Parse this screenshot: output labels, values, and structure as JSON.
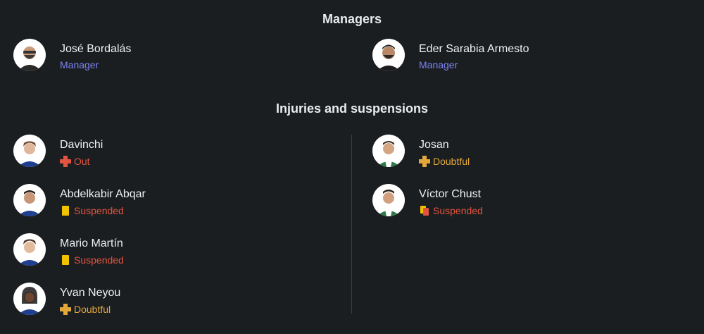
{
  "managers": {
    "title": "Managers",
    "items": [
      {
        "name": "José Bordalás",
        "role": "Manager"
      },
      {
        "name": "Eder Sarabia Armesto",
        "role": "Manager"
      }
    ]
  },
  "injuries": {
    "title": "Injuries and suspensions",
    "left": [
      {
        "name": "Davinchi",
        "status": "Out",
        "status_icon": "red-cross-icon"
      },
      {
        "name": "Abdelkabir Abqar",
        "status": "Suspended",
        "status_icon": "yellow-card-icon"
      },
      {
        "name": "Mario Martín",
        "status": "Suspended",
        "status_icon": "yellow-card-icon"
      },
      {
        "name": "Yvan Neyou",
        "status": "Doubtful",
        "status_icon": "amber-cross-icon"
      }
    ],
    "right": [
      {
        "name": "Josan",
        "status": "Doubtful",
        "status_icon": "amber-cross-icon"
      },
      {
        "name": "Víctor Chust",
        "status": "Suspended",
        "status_icon": "second-yellow-red-card-icon"
      }
    ]
  },
  "colors": {
    "background": "#1b1e21",
    "role": "#7b83f0",
    "status_red": "#e2543f",
    "status_amber": "#e4a83a",
    "yellow_card": "#f2c200",
    "red_card": "#e2543f"
  }
}
